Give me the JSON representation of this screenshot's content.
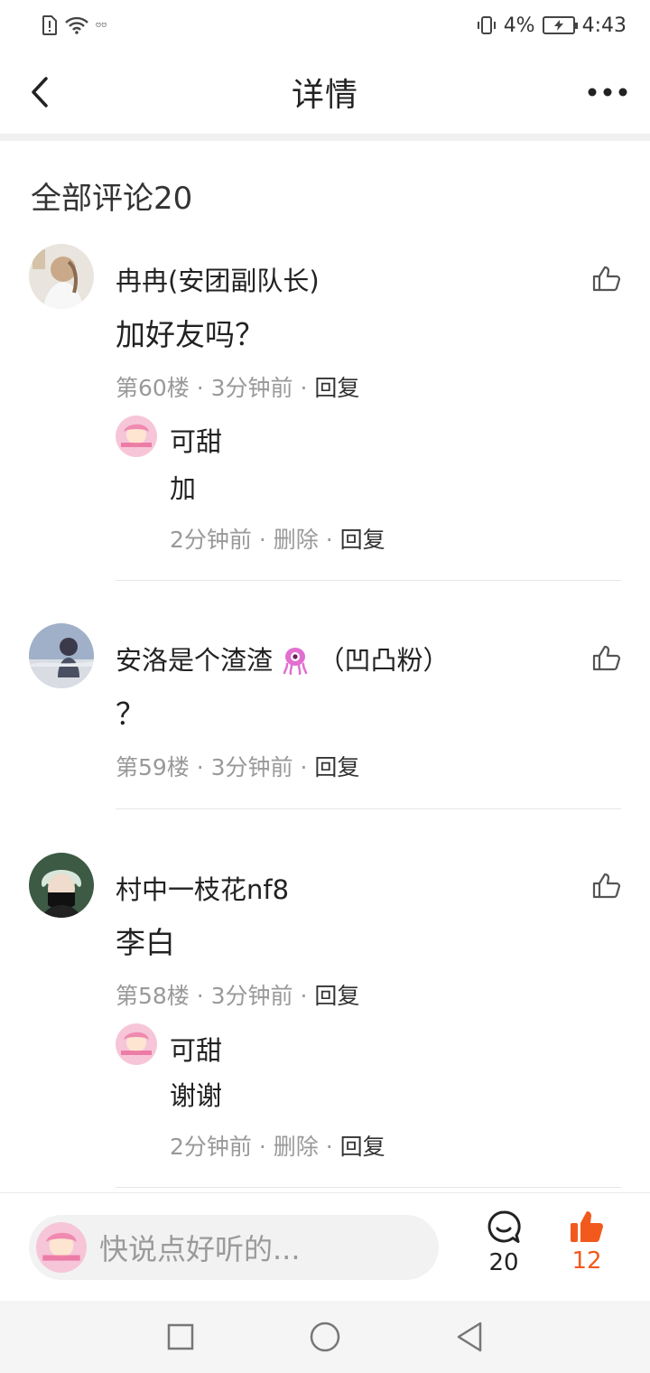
{
  "status_bar": {
    "left_tiny_text": "ဗဗ",
    "battery_percent": "4%",
    "time": "4:43"
  },
  "header": {
    "title": "详情",
    "back_icon": "chevron-left-icon",
    "more_icon": "more-dots-icon"
  },
  "section": {
    "title": "全部评论20"
  },
  "comments": [
    {
      "author": "冉冉(安团副队长)",
      "text": "加好友吗？",
      "floor": "第60楼",
      "time": "3分钟前",
      "reply_label": "回复",
      "reply": {
        "author": "可甜",
        "text": "加",
        "time": "2分钟前",
        "delete_label": "删除",
        "reply_label": "回复"
      }
    },
    {
      "author": "安洛是个渣渣",
      "author_suffix": "（凹凸粉）",
      "text": "？",
      "floor": "第59楼",
      "time": "3分钟前",
      "reply_label": "回复"
    },
    {
      "author": "村中一枝花nf8",
      "text": "李白",
      "floor": "第58楼",
      "time": "3分钟前",
      "reply_label": "回复",
      "reply": {
        "author": "可甜",
        "text": "谢谢",
        "time": "2分钟前",
        "delete_label": "删除",
        "reply_label": "回复"
      }
    }
  ],
  "separator": " · ",
  "bottom_bar": {
    "placeholder": "快说点好听的...",
    "comment_count": "20",
    "like_count": "12",
    "accent_color": "#f25a1d"
  }
}
